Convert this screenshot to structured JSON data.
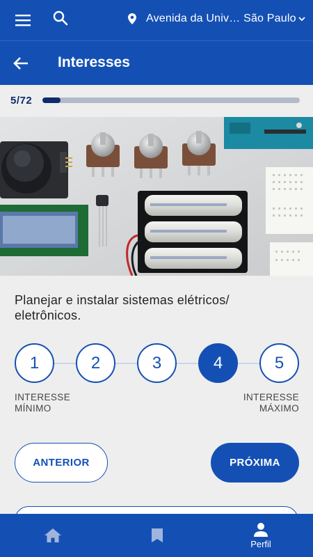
{
  "colors": {
    "primary": "#1450b4",
    "dark_accent": "#0e2c6b",
    "background": "#eeeeee"
  },
  "topbar": {
    "menu_icon": "menu-icon",
    "search_icon": "search-icon",
    "location_icon": "location-pin-icon",
    "location_text": "Avenida da Univ… São Paulo",
    "chevron_icon": "chevron-down-icon"
  },
  "page": {
    "title": "Interesses",
    "back_icon": "arrow-back-icon"
  },
  "progress": {
    "text": "5/72",
    "current": 5,
    "total": 72
  },
  "question": {
    "text": "Planejar e instalar sistemas elétricos/ eletrônicos."
  },
  "scale": {
    "options": [
      "1",
      "2",
      "3",
      "4",
      "5"
    ],
    "selected": "4",
    "min_label_line1": "INTERESSE",
    "min_label_line2": "MÍNIMO",
    "max_label_line1": "INTERESSE",
    "max_label_line2": "MÁXIMO"
  },
  "buttons": {
    "previous": "ANTERIOR",
    "next": "PRÓXIMA"
  },
  "bottomnav": {
    "home_icon": "home-icon",
    "saved_icon": "bookmark-icon",
    "profile_icon": "person-icon",
    "profile_label": "Perfil"
  }
}
